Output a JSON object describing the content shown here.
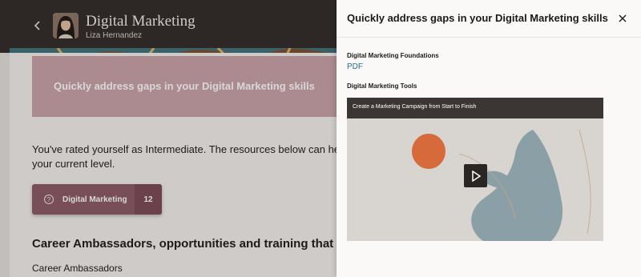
{
  "header": {
    "back_icon": "chevron-left-icon",
    "title": "Digital Marketing",
    "subtitle": "Liza Hernandez"
  },
  "main": {
    "banner_text": "Quickly address gaps in your Digital Marketing skills",
    "rated_line1": "You've rated yourself as Intermediate. The resources below can help you g",
    "rated_line2": "your current level.",
    "skill_button": {
      "label": "Digital Marketing",
      "count": "12",
      "icon": "skill-icon"
    },
    "career_heading": "Career Ambassadors, opportunities and training that help yo",
    "career_subheading": "Career Ambassadors"
  },
  "drawer": {
    "title": "Quickly address gaps in your Digital Marketing skills",
    "close_icon": "close-icon",
    "section1_label": "Digital Marketing Foundations",
    "section1_link": "PDF",
    "section2_label": "Digital Marketing Tools",
    "video": {
      "title": "Create a Marketing Campaign from Start to Finish",
      "play_icon": "play-icon"
    }
  },
  "colors": {
    "topbar": "#2f2a26",
    "rose_box": "#c9a3a8",
    "skill_button": "#8a5a64",
    "link": "#1f6f8b",
    "video_orange": "#d76a3a",
    "video_blue": "#8aa0a6"
  }
}
